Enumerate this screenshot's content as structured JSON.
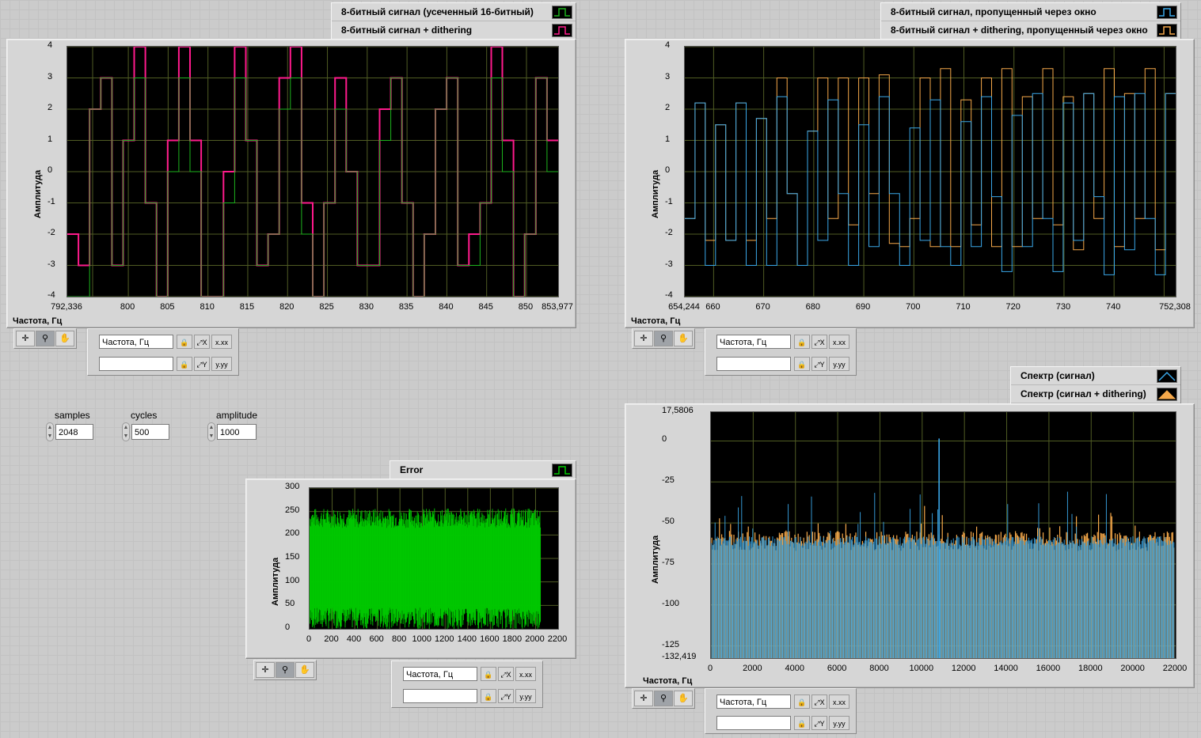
{
  "colors": {
    "green": "#1db31d",
    "pink": "#ff1a8c",
    "blue": "#3aa7e8",
    "orange": "#f5a84a",
    "bright_green": "#00c800",
    "grid": "#505c24"
  },
  "icons": [
    "crosshair-icon",
    "zoom-icon",
    "hand-pan-icon",
    "lock-icon",
    "autoscale-icon",
    "format-icon"
  ],
  "graph1": {
    "legend": [
      "8-битный сигнал (усеченный 16-битный)",
      "8-битный сигнал + dithering"
    ],
    "ylabel": "Амплитуда",
    "xtitle": "Частота, Гц",
    "xticks": [
      "792,336",
      "800",
      "805",
      "810",
      "815",
      "820",
      "825",
      "830",
      "835",
      "840",
      "845",
      "850",
      "853,977"
    ],
    "yticks": [
      "4",
      "3",
      "2",
      "1",
      "0",
      "-1",
      "-2",
      "-3",
      "-4"
    ],
    "scale_names": [
      "Частота, Гц",
      ""
    ]
  },
  "graph2": {
    "legend": [
      "8-битный сигнал, пропущенный через окно",
      "8-битный сигнал + dithering, пропущенный через окно"
    ],
    "ylabel": "Амплитуда",
    "xtitle": "Частота, Гц",
    "xticks": [
      "654,244",
      "660",
      "670",
      "680",
      "690",
      "700",
      "710",
      "720",
      "730",
      "740",
      "752,308"
    ],
    "yticks": [
      "4",
      "3",
      "2",
      "1",
      "0",
      "-1",
      "-2",
      "-3",
      "-4"
    ],
    "scale_names": [
      "Частота, Гц",
      ""
    ]
  },
  "controls": [
    {
      "label": "samples",
      "value": "2048"
    },
    {
      "label": "cycles",
      "value": "500"
    },
    {
      "label": "amplitude",
      "value": "1000"
    }
  ],
  "graph3": {
    "legend": [
      "Error"
    ],
    "ylabel": "Амплитуда",
    "xticks": [
      "0",
      "200",
      "400",
      "600",
      "800",
      "1000",
      "1200",
      "1400",
      "1600",
      "1800",
      "2000",
      "2200"
    ],
    "yticks": [
      "300",
      "250",
      "200",
      "150",
      "100",
      "50",
      "0"
    ],
    "scale_names": [
      "Частота, Гц",
      ""
    ]
  },
  "graph4": {
    "legend": [
      "Спектр (сигнал)",
      "Спектр (сигнал + dithering)"
    ],
    "ylabel": "Амплитуда",
    "xtitle": "Частота, Гц",
    "xticks": [
      "0",
      "2000",
      "4000",
      "6000",
      "8000",
      "10000",
      "12000",
      "14000",
      "16000",
      "18000",
      "20000",
      "22000"
    ],
    "yticks": [
      "17,5806",
      "0",
      "-25",
      "-50",
      "-75",
      "-100",
      "-125",
      "-132,419"
    ],
    "scale_names": [
      "Частота, Гц",
      ""
    ]
  },
  "chart_data": [
    {
      "type": "line",
      "title": "",
      "xlabel": "Частота, Гц",
      "ylabel": "Амплитуда",
      "xlim": [
        792.336,
        853.977
      ],
      "ylim": [
        -4,
        4
      ],
      "series": [
        {
          "name": "8-битный сигнал (усеченный 16-битный)",
          "values": [
            -4,
            -4,
            2,
            3,
            -3,
            1,
            3,
            -1,
            -4,
            0,
            3,
            0,
            -4,
            -4,
            -1,
            3,
            1,
            -3,
            -2,
            2,
            3,
            -2,
            -4,
            -1,
            2,
            0,
            -3,
            -3,
            1,
            3,
            -1,
            -4,
            -2,
            2,
            3,
            -3,
            -3,
            -1,
            3,
            0,
            -4,
            -2,
            3,
            0
          ]
        },
        {
          "name": "8-битный сигнал + dithering",
          "values": [
            -2,
            -3,
            2,
            3,
            -3,
            1,
            4,
            -1,
            -4,
            1,
            4,
            1,
            -4,
            -4,
            0,
            4,
            1,
            -3,
            -2,
            3,
            4,
            -1,
            -4,
            -1,
            3,
            0,
            -3,
            -3,
            2,
            3,
            -1,
            -4,
            -2,
            2,
            3,
            -3,
            -2,
            -1,
            4,
            1,
            -4,
            -2,
            3,
            1
          ]
        }
      ]
    },
    {
      "type": "line",
      "title": "",
      "xlabel": "Частота, Гц",
      "ylabel": "Амплитуда",
      "xlim": [
        654.244,
        752.308
      ],
      "ylim": [
        -4,
        4
      ],
      "series": [
        {
          "name": "8-битный сигнал, пропущенный через окно",
          "values": [
            -1.5,
            2.2,
            -3,
            1.5,
            -2.2,
            2.2,
            -3,
            1.7,
            -3,
            2.4,
            -0.7,
            -3,
            1.3,
            -2.2,
            2.3,
            -0.7,
            -3,
            1.5,
            -2.4,
            2.4,
            -0.7,
            -3,
            1.4,
            -2.2,
            2.3,
            -2.4,
            -3,
            1.6,
            -2.4,
            2.4,
            -0.8,
            -3.2,
            1.8,
            -2.4,
            2.5,
            -1.5,
            -3.2,
            2.2,
            -2.2,
            2.5,
            -0.8,
            -3.3,
            2.4,
            -2.5,
            2.5,
            -1.5,
            -3.3,
            2.5
          ]
        },
        {
          "name": "8-битный сигнал + dithering, пропущенный через окно",
          "values": [
            -1.5,
            2.2,
            -2.2,
            1.5,
            -2.2,
            2.2,
            -2.2,
            1.7,
            -1.5,
            3,
            -0.7,
            -3,
            1.3,
            3,
            -1.5,
            3,
            -1.7,
            3,
            -0.7,
            3.1,
            -2.3,
            -2.4,
            -1.5,
            3,
            -2.4,
            3.3,
            -2.4,
            2.3,
            -1.7,
            3,
            -2.4,
            3.3,
            -2.4,
            2.4,
            -1.5,
            3.3,
            -1.7,
            2.4,
            -2.5,
            2.5,
            -1.5,
            3.3,
            -2.4,
            2.5,
            -1.5,
            3.3,
            -2.5,
            2.5
          ]
        }
      ]
    },
    {
      "type": "area",
      "title": "",
      "xlabel": "",
      "ylabel": "Амплитуда",
      "xlim": [
        0,
        2200
      ],
      "ylim": [
        0,
        300
      ],
      "series": [
        {
          "name": "Error",
          "x": [
            0,
            2047
          ],
          "band": [
            0,
            255
          ]
        }
      ]
    },
    {
      "type": "line",
      "title": "",
      "xlabel": "Частота, Гц",
      "ylabel": "Амплитуда",
      "xlim": [
        0,
        22000
      ],
      "ylim": [
        -132.419,
        17.5806
      ],
      "series": [
        {
          "name": "Спектр (сигнал)",
          "peak": {
            "x": 10800,
            "y": 1.5
          },
          "floor": -58
        },
        {
          "name": "Спектр (сигнал + dithering)",
          "floor": -55
        }
      ]
    }
  ]
}
